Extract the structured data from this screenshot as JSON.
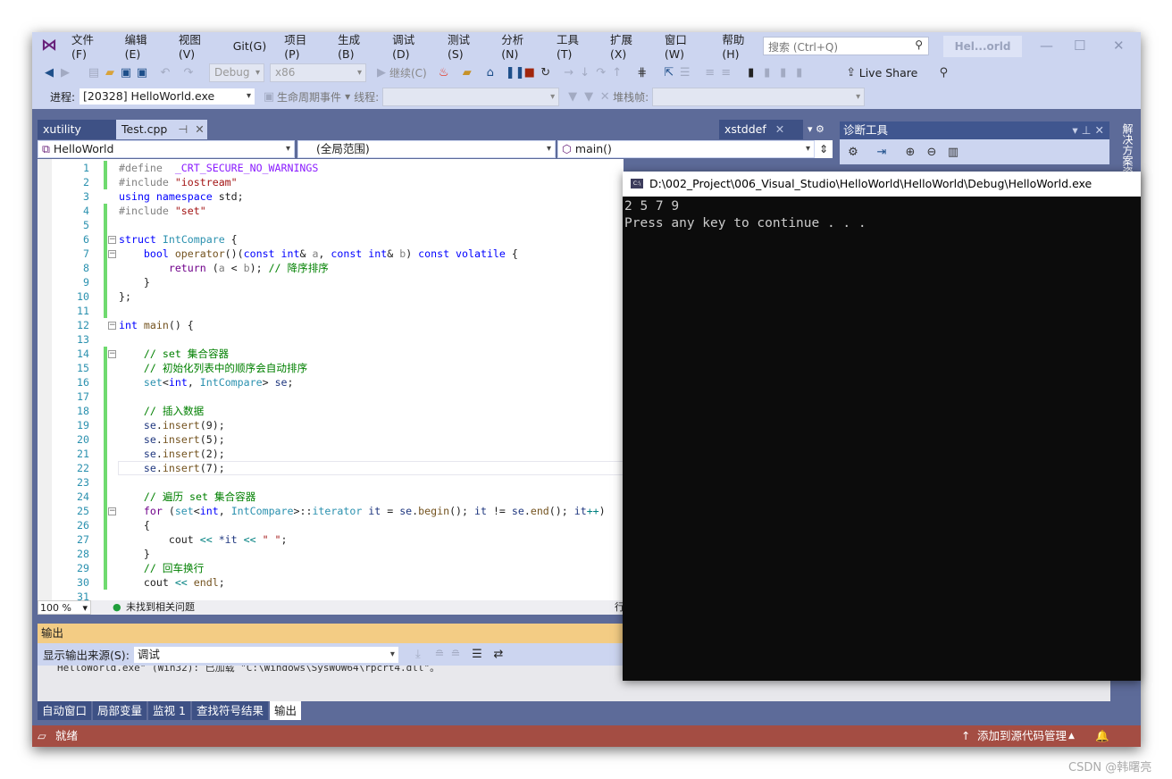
{
  "menu": {
    "items": [
      "文件(F)",
      "编辑(E)",
      "视图(V)",
      "Git(G)",
      "项目(P)",
      "生成(B)",
      "调试(D)",
      "测试(S)",
      "分析(N)",
      "工具(T)",
      "扩展(X)",
      "窗口(W)",
      "帮助(H)"
    ],
    "search_placeholder": "搜索 (Ctrl+Q)",
    "solution_badge": "Hel...orld"
  },
  "toolbar": {
    "config": "Debug",
    "platform": "x86",
    "continue": "继续(C)",
    "live_share": "Live Share",
    "process_label": "进程:",
    "process_value": "[20328] HelloWorld.exe",
    "lifecycle": "生命周期事件",
    "thread_label": "线程:",
    "stack_label": "堆栈帧:"
  },
  "tabs": {
    "xutility": "xutility",
    "active": "Test.cpp",
    "xstddef": "xstddef"
  },
  "nav": {
    "project": "HelloWorld",
    "scope": "(全局范围)",
    "member": "main()"
  },
  "diag": {
    "title": "诊断工具"
  },
  "side_panel": {
    "label": "解决方案资源"
  },
  "code": [
    [
      [
        "#define  ",
        "p"
      ],
      [
        "_CRT_SECURE_NO_WARNINGS",
        "x"
      ]
    ],
    [
      [
        "#include ",
        "p"
      ],
      [
        "\"iostream\"",
        "s"
      ]
    ],
    [
      [
        "using ",
        "k"
      ],
      [
        "namespace ",
        "k"
      ],
      [
        "std;",
        "n"
      ]
    ],
    [
      [
        "#include ",
        "p"
      ],
      [
        "\"set\"",
        "s"
      ]
    ],
    [],
    [
      [
        "struct ",
        "k"
      ],
      [
        "IntCompare ",
        "t"
      ],
      [
        "{",
        "n"
      ]
    ],
    [
      [
        "    bool ",
        "k"
      ],
      [
        "operator",
        "f"
      ],
      [
        "()(",
        "n"
      ],
      [
        "const ",
        "k"
      ],
      [
        "int",
        "k"
      ],
      [
        "& ",
        "n"
      ],
      [
        "a",
        "p"
      ],
      [
        ", ",
        "n"
      ],
      [
        "const ",
        "k"
      ],
      [
        "int",
        "k"
      ],
      [
        "& ",
        "n"
      ],
      [
        "b",
        "p"
      ],
      [
        ") ",
        "n"
      ],
      [
        "const ",
        "k"
      ],
      [
        "volatile ",
        "k"
      ],
      [
        "{",
        "n"
      ]
    ],
    [
      [
        "        return ",
        "m"
      ],
      [
        "(",
        "n"
      ],
      [
        "a ",
        "p"
      ],
      [
        "< ",
        "n"
      ],
      [
        "b",
        "p"
      ],
      [
        "); ",
        "n"
      ],
      [
        "// 降序排序",
        "c"
      ]
    ],
    [
      [
        "    }",
        "n"
      ]
    ],
    [
      [
        "};",
        "n"
      ]
    ],
    [],
    [
      [
        "int ",
        "k"
      ],
      [
        "main",
        "f"
      ],
      [
        "() {",
        "n"
      ]
    ],
    [],
    [
      [
        "    // set 集合容器",
        "c"
      ]
    ],
    [
      [
        "    // 初始化列表中的顺序会自动排序",
        "c"
      ]
    ],
    [
      [
        "    set",
        "t"
      ],
      [
        "<",
        "n"
      ],
      [
        "int",
        "k"
      ],
      [
        ", ",
        "n"
      ],
      [
        "IntCompare",
        "t"
      ],
      [
        "> ",
        "n"
      ],
      [
        "se",
        "v"
      ],
      [
        ";",
        "n"
      ]
    ],
    [],
    [
      [
        "    // 插入数据",
        "c"
      ]
    ],
    [
      [
        "    se",
        "v"
      ],
      [
        ".",
        "n"
      ],
      [
        "insert",
        "f"
      ],
      [
        "(9);",
        "n"
      ]
    ],
    [
      [
        "    se",
        "v"
      ],
      [
        ".",
        "n"
      ],
      [
        "insert",
        "f"
      ],
      [
        "(5);",
        "n"
      ]
    ],
    [
      [
        "    se",
        "v"
      ],
      [
        ".",
        "n"
      ],
      [
        "insert",
        "f"
      ],
      [
        "(2);",
        "n"
      ]
    ],
    [
      [
        "    se",
        "v"
      ],
      [
        ".",
        "n"
      ],
      [
        "insert",
        "f"
      ],
      [
        "(7);",
        "n"
      ]
    ],
    [],
    [
      [
        "    // 遍历 set 集合容器",
        "c"
      ]
    ],
    [
      [
        "    for ",
        "m"
      ],
      [
        "(",
        "n"
      ],
      [
        "set",
        "t"
      ],
      [
        "<",
        "n"
      ],
      [
        "int",
        "k"
      ],
      [
        ", ",
        "n"
      ],
      [
        "IntCompare",
        "t"
      ],
      [
        ">::",
        "n"
      ],
      [
        "iterator ",
        "t"
      ],
      [
        "it ",
        "v"
      ],
      [
        "= ",
        "n"
      ],
      [
        "se",
        "v"
      ],
      [
        ".",
        "n"
      ],
      [
        "begin",
        "f"
      ],
      [
        "(); ",
        "n"
      ],
      [
        "it ",
        "v"
      ],
      [
        "!= ",
        "n"
      ],
      [
        "se",
        "v"
      ],
      [
        ".",
        "n"
      ],
      [
        "end",
        "f"
      ],
      [
        "(); ",
        "n"
      ],
      [
        "it",
        "v"
      ],
      [
        "++",
        "o"
      ],
      [
        ")",
        "n"
      ]
    ],
    [
      [
        "    {",
        "n"
      ]
    ],
    [
      [
        "        cout ",
        "n"
      ],
      [
        "<< ",
        "o"
      ],
      [
        "*it ",
        "v"
      ],
      [
        "<< ",
        "o"
      ],
      [
        "\" \"",
        "s"
      ],
      [
        ";",
        "n"
      ]
    ],
    [
      [
        "    }",
        "n"
      ]
    ],
    [
      [
        "    // 回车换行",
        "c"
      ]
    ],
    [
      [
        "    cout ",
        "n"
      ],
      [
        "<< ",
        "o"
      ],
      [
        "endl",
        "f"
      ],
      [
        ";",
        "n"
      ]
    ],
    []
  ],
  "editor_status": {
    "zoom": "100 %",
    "issues": "未找到相关问题",
    "line_label": "行"
  },
  "output": {
    "title": "输出",
    "source_label": "显示输出来源(S):",
    "source_value": "调试",
    "text": "HelloWorld.exe\" (Win32): 已加载 \"C:\\Windows\\SysWOW64\\rpcrt4.dll\"。"
  },
  "bottom_tabs": [
    "自动窗口",
    "局部变量",
    "监视 1",
    "查找符号结果",
    "输出"
  ],
  "status": {
    "ready": "就绪",
    "source_control": "添加到源代码管理"
  },
  "console": {
    "title": "D:\\002_Project\\006_Visual_Studio\\HelloWorld\\HelloWorld\\Debug\\HelloWorld.exe",
    "lines": [
      "2 5 7 9",
      "Press any key to continue . . ."
    ]
  },
  "watermark": "CSDN @韩曙亮",
  "colors": {
    "status_bar": "#a44d43",
    "output_header": "#f3cc84",
    "chrome": "#ccd5f0",
    "band": "#5d6b99"
  }
}
